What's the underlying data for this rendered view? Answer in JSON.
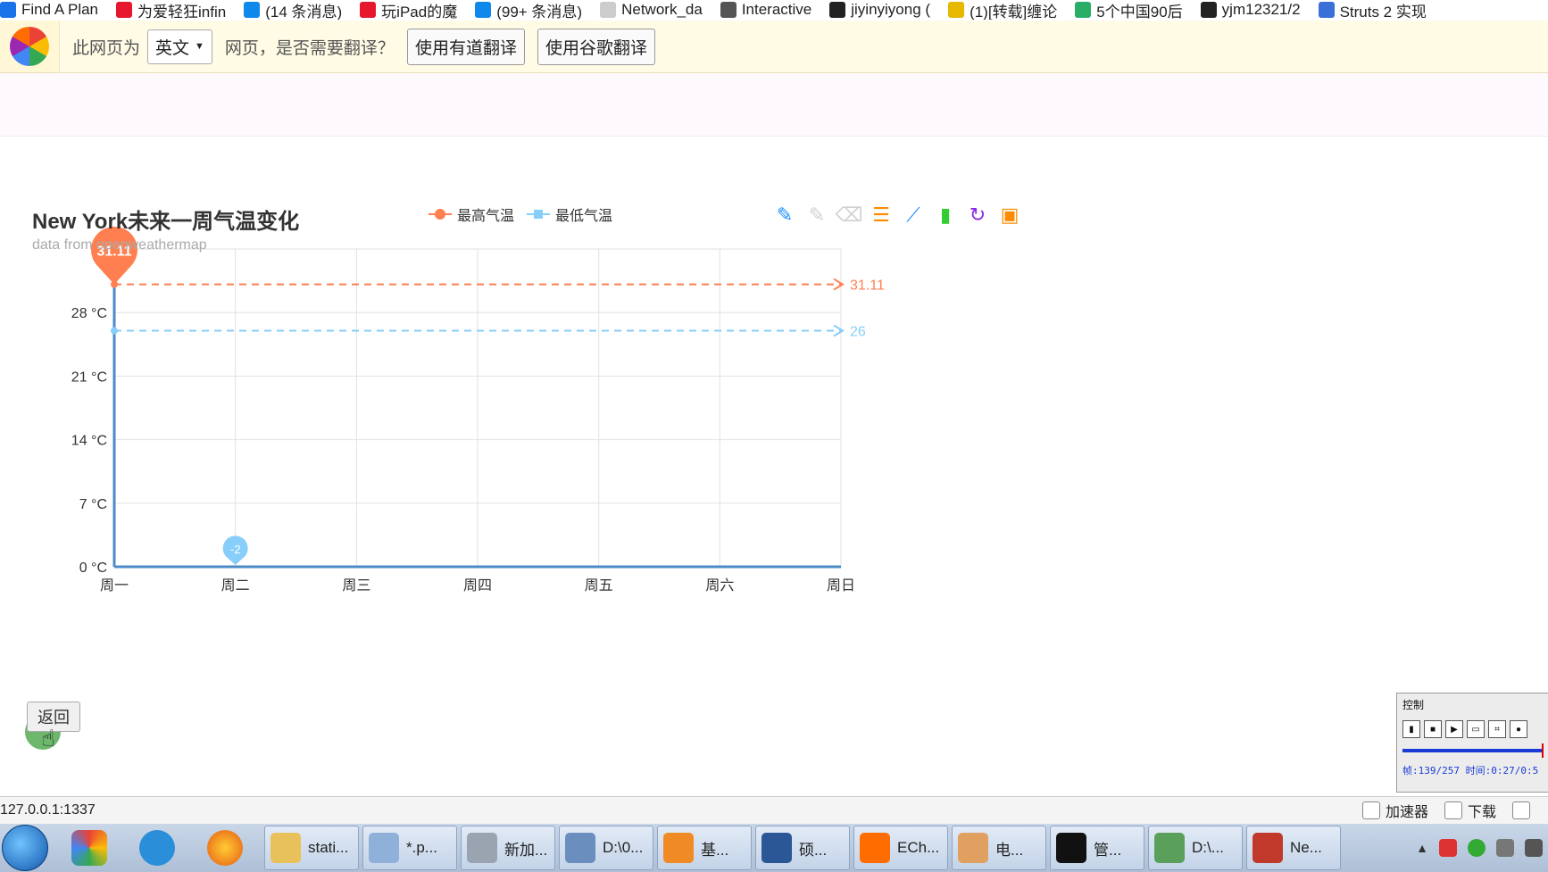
{
  "bookmarks": [
    {
      "label": "Find A Plan",
      "icon": "b-icon",
      "color": "#1a73e8"
    },
    {
      "label": "为爱轻狂infin",
      "icon": "weibo-icon",
      "color": "#e6162d"
    },
    {
      "label": "(14 条消息)",
      "icon": "zhihu-icon",
      "color": "#0f88eb"
    },
    {
      "label": "玩iPad的魔",
      "icon": "weibo-icon",
      "color": "#e6162d"
    },
    {
      "label": "(99+ 条消息)",
      "icon": "zhihu-icon",
      "color": "#0f88eb"
    },
    {
      "label": "Network_da",
      "icon": "page-icon",
      "color": "#cccccc"
    },
    {
      "label": "Interactive",
      "icon": "ml-icon",
      "color": "#555555"
    },
    {
      "label": "jiyinyiyong (",
      "icon": "github-icon",
      "color": "#222222"
    },
    {
      "label": "(1)[转载]缠论",
      "icon": "colorful-icon",
      "color": "#e6b800"
    },
    {
      "label": "5个中国90后",
      "icon": "wechat-icon",
      "color": "#2aae67"
    },
    {
      "label": "yjm12321/2",
      "icon": "github-icon",
      "color": "#222222"
    },
    {
      "label": "Struts 2 实现",
      "icon": "site-icon",
      "color": "#3a6fd8"
    }
  ],
  "translate_bar": {
    "prefix": "此网页为",
    "language": "英文",
    "suffix": "网页，是否需要翻译？",
    "youdao_button": "使用有道翻译",
    "google_button": "使用谷歌翻译"
  },
  "chart_data": {
    "type": "line",
    "title": "New York未来一周气温变化",
    "subtitle": "data from openweathermap",
    "categories": [
      "周一",
      "周二",
      "周三",
      "周四",
      "周五",
      "周六",
      "周日"
    ],
    "yticks": [
      "35",
      "28 °C",
      "21 °C",
      "14 °C",
      "7 °C",
      "0 °C"
    ],
    "ylim": [
      0,
      35
    ],
    "grid": true,
    "legend_position": "top",
    "series": [
      {
        "name": "最高气温",
        "color": "#ff7f50",
        "mark_point_max": 31.11,
        "mark_line_value": 31.11
      },
      {
        "name": "最低气温",
        "color": "#87cefa",
        "mark_point_min": -2,
        "mark_line_value": 26
      }
    ],
    "mark_point_labels": {
      "max": "31.11",
      "min": "-2"
    },
    "mark_line_labels": {
      "high": "31.11",
      "low": "26"
    }
  },
  "toolbox": [
    {
      "name": "mark-icon",
      "color": "#1e90ff"
    },
    {
      "name": "mark-undo-icon",
      "color": "#d0d0d0"
    },
    {
      "name": "mark-clear-icon",
      "color": "#d0d0d0"
    },
    {
      "name": "data-view-icon",
      "color": "#ff8c00"
    },
    {
      "name": "line-chart-icon",
      "color": "#1e90ff"
    },
    {
      "name": "bar-chart-icon",
      "color": "#32cd32"
    },
    {
      "name": "restore-icon",
      "color": "#8a2be2"
    },
    {
      "name": "save-icon",
      "color": "#ff8c00"
    }
  ],
  "back_button": "返回",
  "control_window": {
    "title": "控制",
    "status": "帧:139/257 时间:0:27/0:5"
  },
  "status_bar": {
    "url": "127.0.0.1:1337",
    "accelerator": "加速器",
    "download": "下载"
  },
  "taskbar": {
    "tasks": [
      {
        "label": "stati...",
        "color": "#e8c15a"
      },
      {
        "label": "*.p...",
        "color": "#8fb0d8"
      },
      {
        "label": "新加...",
        "color": "#9aa4b0"
      },
      {
        "label": "D:\\0...",
        "color": "#6a8fbf"
      },
      {
        "label": "基...",
        "color": "#f08a24"
      },
      {
        "label": "硕...",
        "color": "#2b5797"
      },
      {
        "label": "ECh...",
        "color": "#ff6d00"
      },
      {
        "label": "电...",
        "color": "#e0a060"
      },
      {
        "label": "管...",
        "color": "#111111"
      },
      {
        "label": "D:\\...",
        "color": "#5aa05a"
      },
      {
        "label": "Ne...",
        "color": "#c0392b"
      }
    ]
  }
}
